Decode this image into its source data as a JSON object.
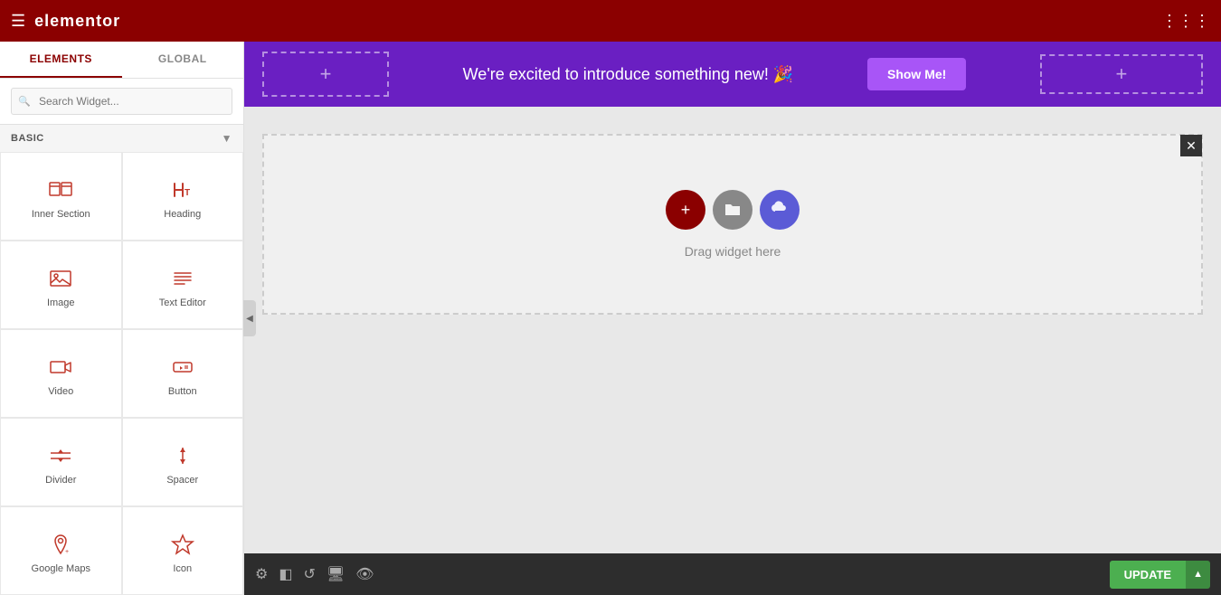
{
  "header": {
    "title": "elementor",
    "hamburger_label": "☰",
    "grid_label": "⋮⋮⋮"
  },
  "sidebar": {
    "tab_elements": "ELEMENTS",
    "tab_global": "GLOBAL",
    "search_placeholder": "Search Widget...",
    "section_basic": "BASIC",
    "widgets": [
      {
        "id": "inner-section",
        "label": "Inner Section",
        "icon": "inner-section-icon"
      },
      {
        "id": "heading",
        "label": "Heading",
        "icon": "heading-icon"
      },
      {
        "id": "image",
        "label": "Image",
        "icon": "image-icon"
      },
      {
        "id": "text-editor",
        "label": "Text Editor",
        "icon": "text-editor-icon"
      },
      {
        "id": "video",
        "label": "Video",
        "icon": "video-icon"
      },
      {
        "id": "button",
        "label": "Button",
        "icon": "button-icon"
      },
      {
        "id": "divider",
        "label": "Divider",
        "icon": "divider-icon"
      },
      {
        "id": "spacer",
        "label": "Spacer",
        "icon": "spacer-icon"
      },
      {
        "id": "google-maps",
        "label": "Google Maps",
        "icon": "google-maps-icon"
      },
      {
        "id": "icon",
        "label": "Icon",
        "icon": "icon-widget-icon"
      }
    ]
  },
  "announcement": {
    "message": "We're excited to introduce something new! 🎉",
    "cta_label": "Show Me!"
  },
  "canvas": {
    "drag_hint": "Drag widget here",
    "close_btn": "✕"
  },
  "bottom_toolbar": {
    "update_label": "UPDATE",
    "arrow_label": "▲"
  },
  "colors": {
    "header_bg": "#8b0000",
    "sidebar_accent": "#8b0000",
    "announcement_bg": "#6a1fc2",
    "show_me_bg": "#a855f7",
    "add_btn": "#8b0000",
    "folder_btn": "#888888",
    "cloud_btn": "#5b5bd6",
    "update_btn": "#4CAF50"
  }
}
